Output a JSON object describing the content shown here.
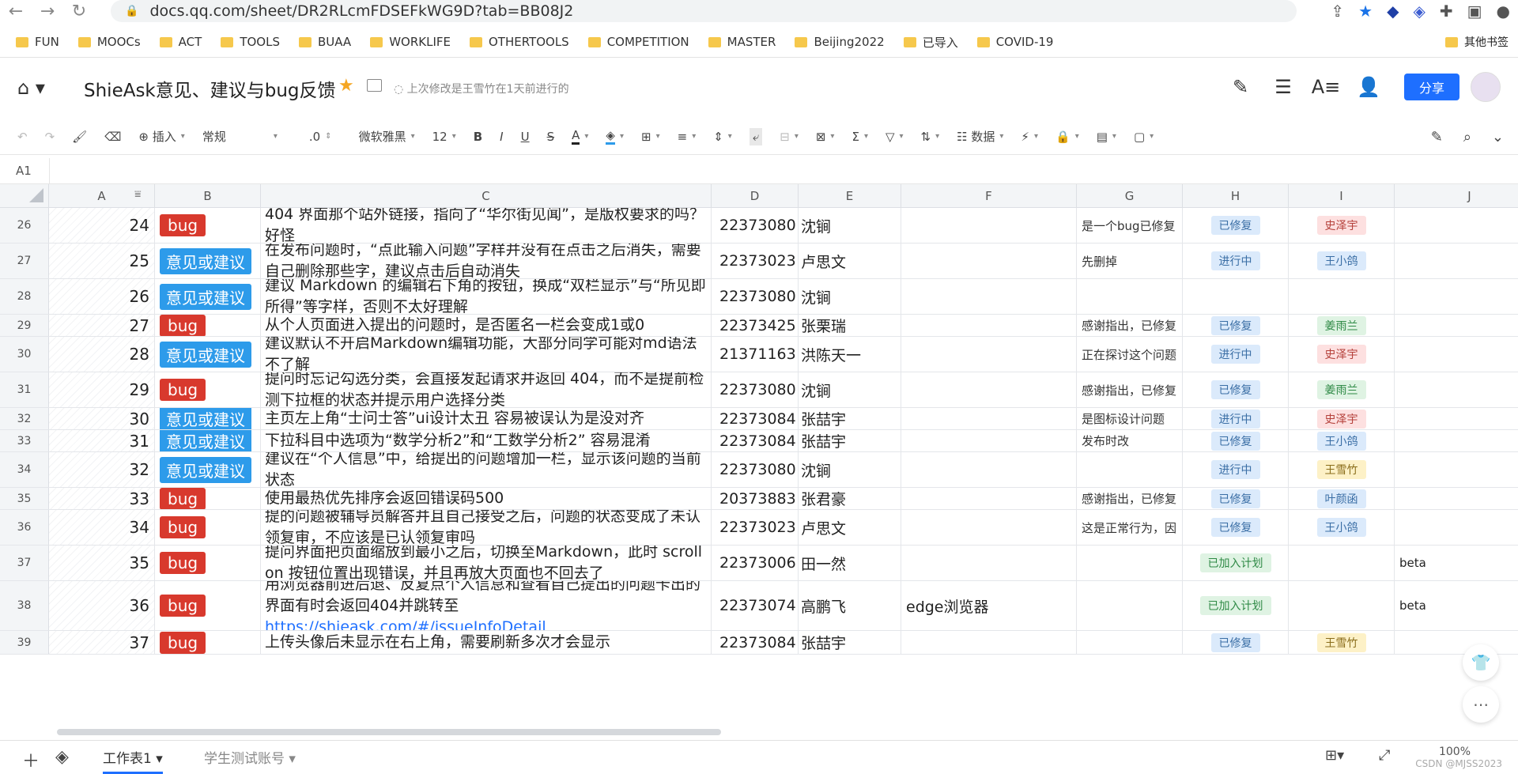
{
  "browser": {
    "url": "docs.qq.com/sheet/DR2RLcmFDSEFkWG9D?tab=BB08J2",
    "bookmarks": [
      "FUN",
      "MOOCs",
      "ACT",
      "TOOLS",
      "BUAA",
      "WORKLIFE",
      "OTHERTOOLS",
      "COMPETITION",
      "MASTER",
      "Beijing2022",
      "已导入",
      "COVID-19"
    ],
    "other_bookmarks": "其他书签"
  },
  "doc": {
    "title": "ShieAsk意见、建议与bug反馈",
    "edit_info": "上次修改是王雪竹在1天前进行的",
    "share_label": "分享"
  },
  "toolbar": {
    "insert": "插入",
    "format": "常规",
    "decimal": ".0",
    "font": "微软雅黑",
    "size": "12",
    "data": "数据"
  },
  "formula": {
    "cell_ref": "A1"
  },
  "columns": [
    "A",
    "B",
    "C",
    "D",
    "E",
    "F",
    "G",
    "H",
    "I",
    "J"
  ],
  "rows": [
    {
      "rn": "26",
      "a": "24",
      "type": "bug",
      "desc": "404 界面那个站外链接，指向了“华尔街见闻”，是版权要求的吗？好怪",
      "id": "22373080",
      "name": "沈锏",
      "env": "",
      "reply": "是一个bug已修复",
      "status": "已修复",
      "status_kind": "fixed",
      "person": "史泽宇",
      "person_kind": "red",
      "ver": ""
    },
    {
      "rn": "27",
      "a": "25",
      "type": "意见或建议",
      "desc": "在发布问题时，“点此输入问题”字样并没有在点击之后消失，需要自己删除那些字，建议点击后自动消失",
      "id": "22373023",
      "name": "卢思文",
      "env": "",
      "reply": "先删掉",
      "status": "进行中",
      "status_kind": "prog",
      "person": "王小鸽",
      "person_kind": "blue",
      "ver": ""
    },
    {
      "rn": "28",
      "a": "26",
      "type": "意见或建议",
      "desc": "建议 Markdown 的编辑右下角的按钮，换成“双栏显示”与“所见即所得”等字样，否则不太好理解",
      "id": "22373080",
      "name": "沈锏",
      "env": "",
      "reply": "",
      "status": "",
      "status_kind": "",
      "person": "",
      "person_kind": "",
      "ver": ""
    },
    {
      "rn": "29",
      "a": "27",
      "type": "bug",
      "desc": "从个人页面进入提出的问题时，是否匿名一栏会变成1或0",
      "id": "22373425",
      "name": "张栗瑞",
      "env": "",
      "reply": "感谢指出，已修复",
      "status": "已修复",
      "status_kind": "fixed",
      "person": "姜雨兰",
      "person_kind": "green",
      "ver": ""
    },
    {
      "rn": "30",
      "a": "28",
      "type": "意见或建议",
      "desc": "建议默认不开启Markdown编辑功能，大部分同学可能对md语法不了解",
      "id": "21371163",
      "name": "洪陈天一",
      "env": "",
      "reply": "正在探讨这个问题",
      "status": "进行中",
      "status_kind": "prog",
      "person": "史泽宇",
      "person_kind": "red",
      "ver": ""
    },
    {
      "rn": "31",
      "a": "29",
      "type": "bug",
      "desc": "提问时忘记勾选分类，会直接发起请求并返回 404，而不是提前检测下拉框的状态并提示用户选择分类",
      "id": "22373080",
      "name": "沈锏",
      "env": "",
      "reply": "感谢指出，已修复",
      "status": "已修复",
      "status_kind": "fixed",
      "person": "姜雨兰",
      "person_kind": "green",
      "ver": ""
    },
    {
      "rn": "32",
      "a": "30",
      "type": "意见或建议",
      "desc": "主页左上角“士问士答”ui设计太丑 容易被误认为是没对齐",
      "id": "22373084",
      "name": "张喆宇",
      "env": "",
      "reply": "是图标设计问题",
      "status": "进行中",
      "status_kind": "prog",
      "person": "史泽宇",
      "person_kind": "red",
      "ver": ""
    },
    {
      "rn": "33",
      "a": "31",
      "type": "意见或建议",
      "desc": "下拉科目中选项为“数学分析2”和“工数学分析2” 容易混淆",
      "id": "22373084",
      "name": "张喆宇",
      "env": "",
      "reply": "发布时改",
      "status": "已修复",
      "status_kind": "fixed",
      "person": "王小鸽",
      "person_kind": "blue",
      "ver": ""
    },
    {
      "rn": "34",
      "a": "32",
      "type": "意见或建议",
      "desc": "建议在“个人信息”中，给提出的问题增加一栏，显示该问题的当前状态",
      "id": "22373080",
      "name": "沈锏",
      "env": "",
      "reply": "",
      "status": "进行中",
      "status_kind": "prog",
      "person": "王雪竹",
      "person_kind": "yellow",
      "ver": ""
    },
    {
      "rn": "35",
      "a": "33",
      "type": "bug",
      "desc": "使用最热优先排序会返回错误码500",
      "id": "20373883",
      "name": "张君豪",
      "env": "",
      "reply": "感谢指出，已修复",
      "status": "已修复",
      "status_kind": "fixed",
      "person": "叶颜函",
      "person_kind": "blue",
      "ver": ""
    },
    {
      "rn": "36",
      "a": "34",
      "type": "bug",
      "desc": "提的问题被辅导员解答并且自己接受之后，问题的状态变成了未认领复审，不应该是已认领复审吗",
      "id": "22373023",
      "name": "卢思文",
      "env": "",
      "reply": "这是正常行为，因",
      "status": "已修复",
      "status_kind": "fixed",
      "person": "王小鸽",
      "person_kind": "blue",
      "ver": ""
    },
    {
      "rn": "37",
      "a": "35",
      "type": "bug",
      "desc": "提问界面把页面缩放到最小之后，切换至Markdown，此时 scroll on 按钮位置出现错误，并且再放大页面也不回去了",
      "id": "22373006",
      "name": "田一然",
      "env": "",
      "reply": "",
      "status": "已加入计划",
      "status_kind": "plan",
      "person": "",
      "person_kind": "",
      "ver": "beta"
    },
    {
      "rn": "38",
      "a": "36",
      "type": "bug",
      "desc": "用浏览器前进后退、反复点个人信息和查看自己提出的问题卡出的界面有时会返回404并跳转至",
      "link": "https://shieask.com/#/issueInfoDetail",
      "id": "22373074",
      "name": "高鹏飞",
      "env": "edge浏览器",
      "reply": "",
      "status": "已加入计划",
      "status_kind": "plan",
      "person": "",
      "person_kind": "",
      "ver": "beta"
    },
    {
      "rn": "39",
      "a": "37",
      "type": "bug",
      "desc": "上传头像后未显示在右上角，需要刷新多次才会显示",
      "id": "22373084",
      "name": "张喆宇",
      "env": "",
      "reply": "",
      "status": "已修复",
      "status_kind": "fixed",
      "person": "王雪竹",
      "person_kind": "yellow",
      "ver": ""
    }
  ],
  "sheets": [
    "工作表1",
    "学生测试账号"
  ],
  "zoom": "100%",
  "watermark": "CSDN @MJSS2023"
}
